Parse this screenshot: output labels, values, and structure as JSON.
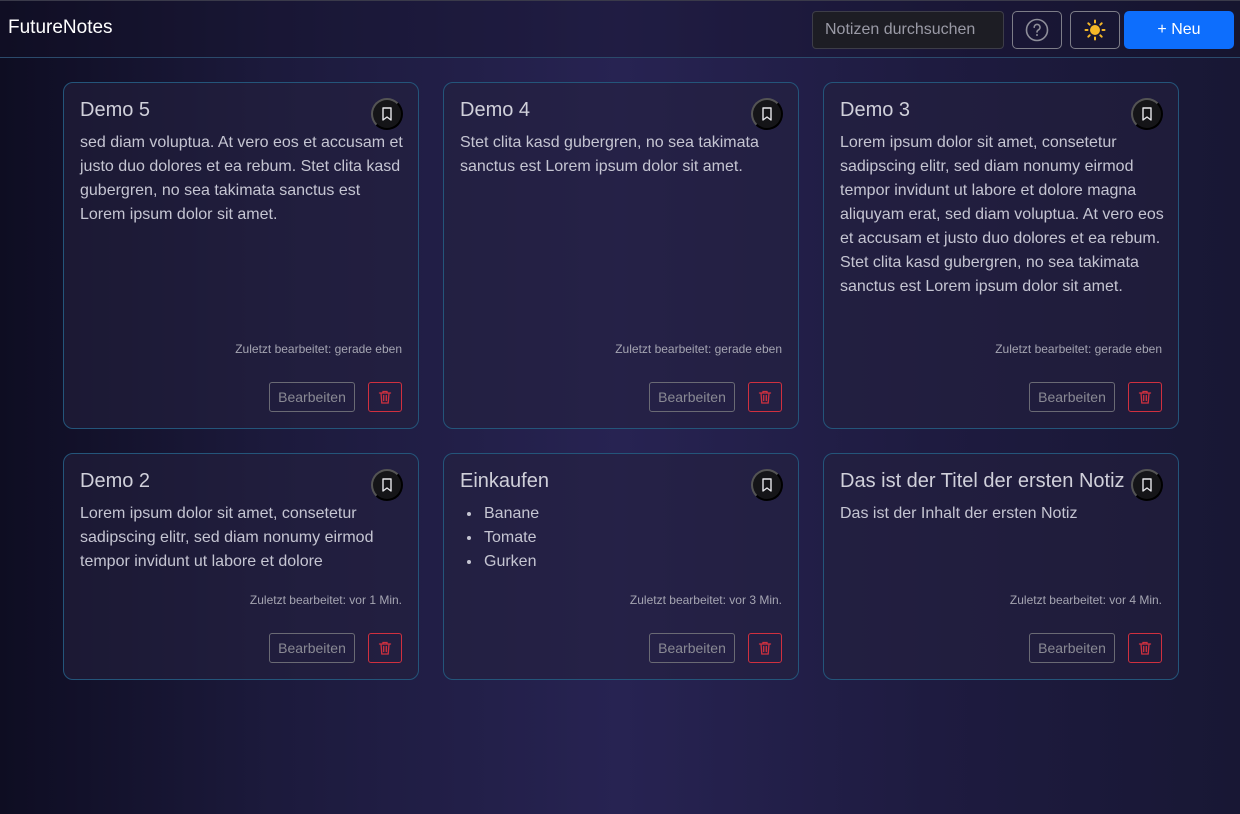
{
  "app": {
    "title": "FutureNotes"
  },
  "header": {
    "search_placeholder": "Notizen durchsuchen",
    "help_icon": "help-circle-icon",
    "theme_icon": "sun-icon",
    "new_label": "+ Neu",
    "new_color": "#0d6efd"
  },
  "labels": {
    "edit": "Bearbeiten"
  },
  "colors": {
    "card_border": "#24557a",
    "delete": "#d0303f"
  },
  "notes": [
    {
      "title": "Demo 5",
      "content": "sed diam voluptua. At vero eos et accusam et justo duo dolores et ea rebum. Stet clita kasd gubergren, no sea takimata sanctus est Lorem ipsum dolor sit amet.",
      "edited": "Zuletzt bearbeitet: gerade eben"
    },
    {
      "title": "Demo 4",
      "content": "Stet clita kasd gubergren, no sea takimata sanctus est Lorem ipsum dolor sit amet.",
      "edited": "Zuletzt bearbeitet: gerade eben"
    },
    {
      "title": "Demo 3",
      "content": "Lorem ipsum dolor sit amet, consetetur sadipscing elitr, sed diam nonumy eirmod tempor invidunt ut labore et dolore magna aliquyam erat, sed diam voluptua. At vero eos et accusam et justo duo dolores et ea rebum. Stet clita kasd gubergren, no sea takimata sanctus est Lorem ipsum dolor sit amet.",
      "edited": "Zuletzt bearbeitet: gerade eben"
    },
    {
      "title": "Demo 2",
      "content": "Lorem ipsum dolor sit amet, consetetur sadipscing elitr, sed diam nonumy eirmod tempor invidunt ut labore et dolore",
      "edited": "Zuletzt bearbeitet: vor 1 Min."
    },
    {
      "title": "Einkaufen",
      "list": [
        "Banane",
        "Tomate",
        "Gurken"
      ],
      "edited": "Zuletzt bearbeitet: vor 3 Min."
    },
    {
      "title": "Das ist der Titel der ersten Notiz",
      "content": "Das ist der Inhalt der ersten Notiz",
      "edited": "Zuletzt bearbeitet: vor 4 Min."
    }
  ]
}
